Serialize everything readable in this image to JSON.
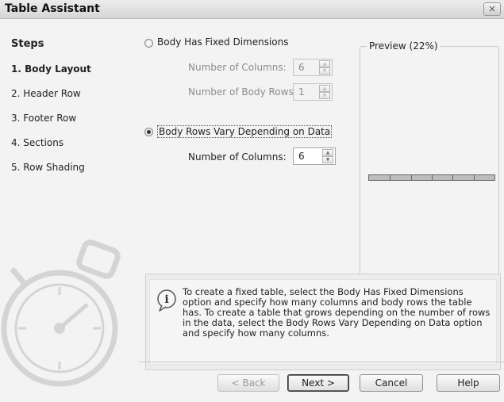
{
  "window": {
    "title": "Table Assistant",
    "close_glyph": "×"
  },
  "sidebar": {
    "heading": "Steps",
    "items": [
      {
        "label": "1. Body Layout",
        "active": true
      },
      {
        "label": "2. Header Row",
        "active": false
      },
      {
        "label": "3. Footer Row",
        "active": false
      },
      {
        "label": "4. Sections",
        "active": false
      },
      {
        "label": "5. Row Shading",
        "active": false
      }
    ],
    "watermark_icon": "stopwatch-icon"
  },
  "options": {
    "fixed": {
      "label": "Body Has Fixed Dimensions",
      "selected": false,
      "columns_label": "Number of Columns:",
      "columns_value": "6",
      "rows_label": "Number of Body Rows:",
      "rows_value": "1"
    },
    "vary": {
      "label": "Body Rows Vary Depending on Data",
      "selected": true,
      "columns_label": "Number of Columns:",
      "columns_value": "6"
    }
  },
  "preview": {
    "legend": "Preview (22%)",
    "table_columns": 6
  },
  "info": {
    "icon": "info-icon",
    "text": "To create a fixed table, select the Body Has Fixed Dimensions option and specify how many columns and body rows the table has. To create a table that grows depending on the number of rows in the data, select the Body Rows Vary Depending on Data option and specify how many columns."
  },
  "buttons": {
    "back": "< Back",
    "next": "Next >",
    "cancel": "Cancel",
    "help": "Help"
  }
}
